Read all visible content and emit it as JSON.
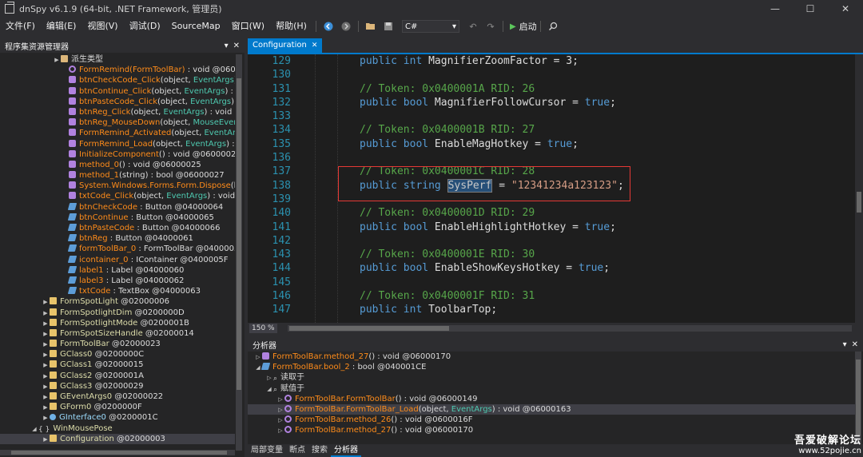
{
  "titlebar": {
    "title": "dnSpy v6.1.9 (64-bit, .NET Framework, 管理员)",
    "minimize": "—",
    "maximize": "☐",
    "close": "✕"
  },
  "menu": {
    "items": [
      "文件(F)",
      "编辑(E)",
      "视图(V)",
      "调试(D)",
      "SourceMap",
      "窗口(W)",
      "帮助(H)"
    ],
    "language": "C#",
    "run_label": "启动"
  },
  "left_panel": {
    "title": "程序集资源管理器",
    "rows": [
      {
        "indent": 66,
        "exp": "▶",
        "icon": "folder",
        "parts": [
          [
            "派生类型",
            "t-white"
          ]
        ]
      },
      {
        "indent": 76,
        "exp": "",
        "icon": "method-priv",
        "parts": [
          [
            "FormRemind(FormToolBar)",
            "t-orange"
          ],
          [
            " : void @0600002",
            "t-white"
          ]
        ]
      },
      {
        "indent": 76,
        "exp": "",
        "icon": "method",
        "parts": [
          [
            "btnCheckCode_Click",
            "t-orange"
          ],
          [
            "(object, ",
            "t-white"
          ],
          [
            "EventArgs",
            "t-cyan"
          ],
          [
            ") : voi",
            "t-white"
          ]
        ]
      },
      {
        "indent": 76,
        "exp": "",
        "icon": "method",
        "parts": [
          [
            "btnContinue_Click",
            "t-orange"
          ],
          [
            "(object, ",
            "t-white"
          ],
          [
            "EventArgs",
            "t-cyan"
          ],
          [
            ") : void (",
            "t-white"
          ]
        ]
      },
      {
        "indent": 76,
        "exp": "",
        "icon": "method",
        "parts": [
          [
            "btnPasteCode_Click",
            "t-orange"
          ],
          [
            "(object, ",
            "t-white"
          ],
          [
            "EventArgs",
            "t-cyan"
          ],
          [
            ") : voi",
            "t-white"
          ]
        ]
      },
      {
        "indent": 76,
        "exp": "",
        "icon": "method",
        "parts": [
          [
            "btnReg_Click",
            "t-orange"
          ],
          [
            "(object, ",
            "t-white"
          ],
          [
            "EventArgs",
            "t-cyan"
          ],
          [
            ") : void @060",
            "t-white"
          ]
        ]
      },
      {
        "indent": 76,
        "exp": "",
        "icon": "method",
        "parts": [
          [
            "btnReg_MouseDown",
            "t-orange"
          ],
          [
            "(object, ",
            "t-white"
          ],
          [
            "MouseEventAr",
            "t-cyan"
          ]
        ]
      },
      {
        "indent": 76,
        "exp": "",
        "icon": "method",
        "parts": [
          [
            "FormRemind_Activated",
            "t-orange"
          ],
          [
            "(object, ",
            "t-white"
          ],
          [
            "EventArgs",
            "t-cyan"
          ],
          [
            ") : v",
            "t-white"
          ]
        ]
      },
      {
        "indent": 76,
        "exp": "",
        "icon": "method",
        "parts": [
          [
            "FormRemind_Load",
            "t-orange"
          ],
          [
            "(object, ",
            "t-white"
          ],
          [
            "EventArgs",
            "t-cyan"
          ],
          [
            ") : void",
            "t-white"
          ]
        ]
      },
      {
        "indent": 76,
        "exp": "",
        "icon": "method",
        "parts": [
          [
            "InitializeComponent",
            "t-orange"
          ],
          [
            "() : void @0600002E",
            "t-white"
          ]
        ]
      },
      {
        "indent": 76,
        "exp": "",
        "icon": "method",
        "parts": [
          [
            "method_0",
            "t-orange"
          ],
          [
            "() : void @06000025",
            "t-white"
          ]
        ]
      },
      {
        "indent": 76,
        "exp": "",
        "icon": "method",
        "parts": [
          [
            "method_1",
            "t-orange"
          ],
          [
            "(string) : bool @06000027",
            "t-white"
          ]
        ]
      },
      {
        "indent": 76,
        "exp": "",
        "icon": "method",
        "parts": [
          [
            "System.Windows.Forms.Form.Dispose",
            "t-orange"
          ],
          [
            "(bool)",
            "t-white"
          ]
        ]
      },
      {
        "indent": 76,
        "exp": "",
        "icon": "method",
        "parts": [
          [
            "txtCode_Click",
            "t-orange"
          ],
          [
            "(object, ",
            "t-white"
          ],
          [
            "EventArgs",
            "t-cyan"
          ],
          [
            ") : void @06",
            "t-white"
          ]
        ]
      },
      {
        "indent": 76,
        "exp": "",
        "icon": "field",
        "parts": [
          [
            "btnCheckCode",
            "t-orange"
          ],
          [
            " : Button @04000064",
            "t-white"
          ]
        ]
      },
      {
        "indent": 76,
        "exp": "",
        "icon": "field",
        "parts": [
          [
            "btnContinue",
            "t-orange"
          ],
          [
            " : Button @04000065",
            "t-white"
          ]
        ]
      },
      {
        "indent": 76,
        "exp": "",
        "icon": "field",
        "parts": [
          [
            "btnPasteCode",
            "t-orange"
          ],
          [
            " : Button @04000066",
            "t-white"
          ]
        ]
      },
      {
        "indent": 76,
        "exp": "",
        "icon": "field",
        "parts": [
          [
            "btnReg",
            "t-orange"
          ],
          [
            " : Button @04000061",
            "t-white"
          ]
        ]
      },
      {
        "indent": 76,
        "exp": "",
        "icon": "field",
        "parts": [
          [
            "formToolBar_0",
            "t-orange"
          ],
          [
            " : FormToolBar @0400005E",
            "t-white"
          ]
        ]
      },
      {
        "indent": 76,
        "exp": "",
        "icon": "field",
        "parts": [
          [
            "icontainer_0",
            "t-orange"
          ],
          [
            " : IContainer @0400005F",
            "t-white"
          ]
        ]
      },
      {
        "indent": 76,
        "exp": "",
        "icon": "field",
        "parts": [
          [
            "label1",
            "t-orange"
          ],
          [
            " : Label @04000060",
            "t-white"
          ]
        ]
      },
      {
        "indent": 76,
        "exp": "",
        "icon": "field",
        "parts": [
          [
            "label3",
            "t-orange"
          ],
          [
            " : Label @04000062",
            "t-white"
          ]
        ]
      },
      {
        "indent": 76,
        "exp": "",
        "icon": "field",
        "parts": [
          [
            "txtCode",
            "t-orange"
          ],
          [
            " : TextBox @04000063",
            "t-white"
          ]
        ]
      },
      {
        "indent": 52,
        "exp": "▶",
        "icon": "class",
        "parts": [
          [
            "FormSpotLight",
            "t-yellow"
          ],
          [
            " @02000006",
            "t-white"
          ]
        ]
      },
      {
        "indent": 52,
        "exp": "▶",
        "icon": "class",
        "parts": [
          [
            "FormSpotlightDim",
            "t-yellow"
          ],
          [
            " @0200000D",
            "t-white"
          ]
        ]
      },
      {
        "indent": 52,
        "exp": "▶",
        "icon": "class",
        "parts": [
          [
            "FormSpotlightMode",
            "t-yellow"
          ],
          [
            " @0200001B",
            "t-white"
          ]
        ]
      },
      {
        "indent": 52,
        "exp": "▶",
        "icon": "class",
        "parts": [
          [
            "FormSpotSizeHandle",
            "t-yellow"
          ],
          [
            " @02000014",
            "t-white"
          ]
        ]
      },
      {
        "indent": 52,
        "exp": "▶",
        "icon": "class",
        "parts": [
          [
            "FormToolBar",
            "t-yellow"
          ],
          [
            " @02000023",
            "t-white"
          ]
        ]
      },
      {
        "indent": 52,
        "exp": "▶",
        "icon": "class",
        "parts": [
          [
            "GClass0",
            "t-yellow"
          ],
          [
            " @0200000C",
            "t-white"
          ]
        ]
      },
      {
        "indent": 52,
        "exp": "▶",
        "icon": "class",
        "parts": [
          [
            "GClass1",
            "t-yellow"
          ],
          [
            " @02000015",
            "t-white"
          ]
        ]
      },
      {
        "indent": 52,
        "exp": "▶",
        "icon": "class",
        "parts": [
          [
            "GClass2",
            "t-yellow"
          ],
          [
            " @0200001A",
            "t-white"
          ]
        ]
      },
      {
        "indent": 52,
        "exp": "▶",
        "icon": "class",
        "parts": [
          [
            "GClass3",
            "t-yellow"
          ],
          [
            " @02000029",
            "t-white"
          ]
        ]
      },
      {
        "indent": 52,
        "exp": "▶",
        "icon": "class",
        "parts": [
          [
            "GEventArgs0",
            "t-yellow"
          ],
          [
            " @02000022",
            "t-white"
          ]
        ]
      },
      {
        "indent": 52,
        "exp": "▶",
        "icon": "class",
        "parts": [
          [
            "GForm0",
            "t-yellow"
          ],
          [
            " @0200000F",
            "t-white"
          ]
        ]
      },
      {
        "indent": 52,
        "exp": "▶",
        "icon": "iface",
        "parts": [
          [
            "GInterface0",
            "t-lightblue"
          ],
          [
            " @0200001C",
            "t-white"
          ]
        ]
      },
      {
        "indent": 38,
        "exp": "◢",
        "icon": "ns",
        "ns": "{ }",
        "parts": [
          [
            "WinMousePose",
            "t-yellow"
          ]
        ]
      },
      {
        "indent": 52,
        "exp": "▶",
        "icon": "class",
        "selected": true,
        "parts": [
          [
            "Configuration",
            "t-yellow"
          ],
          [
            " @02000003",
            "t-white"
          ]
        ]
      }
    ]
  },
  "editor": {
    "tab_label": "Configuration",
    "zoom": "150 %",
    "lines": [
      {
        "n": "129",
        "segs": [
          [
            "public",
            "kw"
          ],
          [
            " ",
            "id"
          ],
          [
            "int",
            "kw"
          ],
          [
            " MagnifierZoomFactor = 3;",
            "id"
          ]
        ]
      },
      {
        "n": "130",
        "segs": []
      },
      {
        "n": "131",
        "segs": [
          [
            "// Token: 0x0400001A RID: 26",
            "cm"
          ]
        ]
      },
      {
        "n": "132",
        "segs": [
          [
            "public",
            "kw"
          ],
          [
            " ",
            "id"
          ],
          [
            "bool",
            "kw"
          ],
          [
            " MagnifierFollowCursor = ",
            "id"
          ],
          [
            "true",
            "kw"
          ],
          [
            ";",
            "id"
          ]
        ]
      },
      {
        "n": "133",
        "segs": []
      },
      {
        "n": "134",
        "segs": [
          [
            "// Token: 0x0400001B RID: 27",
            "cm"
          ]
        ]
      },
      {
        "n": "135",
        "segs": [
          [
            "public",
            "kw"
          ],
          [
            " ",
            "id"
          ],
          [
            "bool",
            "kw"
          ],
          [
            " EnableMagHotkey = ",
            "id"
          ],
          [
            "true",
            "kw"
          ],
          [
            ";",
            "id"
          ]
        ]
      },
      {
        "n": "136",
        "segs": []
      },
      {
        "n": "137",
        "segs": [
          [
            "// Token: 0x0400001C RID: 28",
            "cm"
          ]
        ]
      },
      {
        "n": "138",
        "segs": [
          [
            "public",
            "kw"
          ],
          [
            " ",
            "id"
          ],
          [
            "string",
            "kw"
          ],
          [
            " ",
            "id"
          ],
          [
            "SysPerf",
            "sel-word"
          ],
          [
            " = ",
            "id"
          ],
          [
            "\"12341234a123123\"",
            "str"
          ],
          [
            ";",
            "id"
          ]
        ]
      },
      {
        "n": "139",
        "segs": []
      },
      {
        "n": "140",
        "segs": [
          [
            "// Token: 0x0400001D RID: 29",
            "cm"
          ]
        ]
      },
      {
        "n": "141",
        "segs": [
          [
            "public",
            "kw"
          ],
          [
            " ",
            "id"
          ],
          [
            "bool",
            "kw"
          ],
          [
            " EnableHighlightHotkey = ",
            "id"
          ],
          [
            "true",
            "kw"
          ],
          [
            ";",
            "id"
          ]
        ]
      },
      {
        "n": "142",
        "segs": []
      },
      {
        "n": "143",
        "segs": [
          [
            "// Token: 0x0400001E RID: 30",
            "cm"
          ]
        ]
      },
      {
        "n": "144",
        "segs": [
          [
            "public",
            "kw"
          ],
          [
            " ",
            "id"
          ],
          [
            "bool",
            "kw"
          ],
          [
            " EnableShowKeysHotkey = ",
            "id"
          ],
          [
            "true",
            "kw"
          ],
          [
            ";",
            "id"
          ]
        ]
      },
      {
        "n": "145",
        "segs": []
      },
      {
        "n": "146",
        "segs": [
          [
            "// Token: 0x0400001F RID: 31",
            "cm"
          ]
        ]
      },
      {
        "n": "147",
        "segs": [
          [
            "public",
            "kw"
          ],
          [
            " ",
            "id"
          ],
          [
            "int",
            "kw"
          ],
          [
            " ToolbarTop;",
            "id"
          ]
        ]
      }
    ]
  },
  "analyzer": {
    "title": "分析器",
    "rows": [
      {
        "indent": 8,
        "exp": "▷",
        "icon": "method",
        "parts": [
          [
            "FormToolBar.",
            "t-orange"
          ],
          [
            "method_27",
            "t-orange"
          ],
          [
            "() : void @06000170",
            "t-white"
          ]
        ]
      },
      {
        "indent": 8,
        "exp": "◢",
        "icon": "field",
        "parts": [
          [
            "FormToolBar.",
            "t-orange"
          ],
          [
            "bool_2",
            "t-orange"
          ],
          [
            " : bool @040001CE",
            "t-white"
          ]
        ]
      },
      {
        "indent": 22,
        "exp": "▷",
        "icon": "ns",
        "ns": "⌕",
        "parts": [
          [
            "读取于",
            "t-white"
          ]
        ]
      },
      {
        "indent": 22,
        "exp": "◢",
        "icon": "ns",
        "ns": "⌕",
        "parts": [
          [
            "赋值于",
            "t-white"
          ]
        ]
      },
      {
        "indent": 36,
        "exp": "▷",
        "icon": "method-priv",
        "parts": [
          [
            "FormToolBar.",
            "t-orange"
          ],
          [
            "FormToolBar",
            "t-orange"
          ],
          [
            "() : void @06000149",
            "t-white"
          ]
        ]
      },
      {
        "indent": 36,
        "exp": "▷",
        "icon": "method-priv",
        "highlight": true,
        "parts": [
          [
            "FormToolBar.",
            "t-orange"
          ],
          [
            "FormToolBar_Load",
            "t-orange"
          ],
          [
            "(object, ",
            "t-white"
          ],
          [
            "EventArgs",
            "t-cyan"
          ],
          [
            ") : void @06000163",
            "t-white"
          ]
        ]
      },
      {
        "indent": 36,
        "exp": "▷",
        "icon": "method-priv",
        "parts": [
          [
            "FormToolBar.",
            "t-orange"
          ],
          [
            "method_26",
            "t-orange"
          ],
          [
            "() : void @0600016F",
            "t-white"
          ]
        ]
      },
      {
        "indent": 36,
        "exp": "▷",
        "icon": "method-priv",
        "parts": [
          [
            "FormToolBar.",
            "t-orange"
          ],
          [
            "method_27",
            "t-orange"
          ],
          [
            "() : void @06000170",
            "t-white"
          ]
        ]
      }
    ]
  },
  "bottom_tabs": [
    "局部变量",
    "断点",
    "搜索",
    "分析器"
  ],
  "watermark": {
    "title": "吾爱破解论坛",
    "url": "www.52pojie.cn"
  }
}
